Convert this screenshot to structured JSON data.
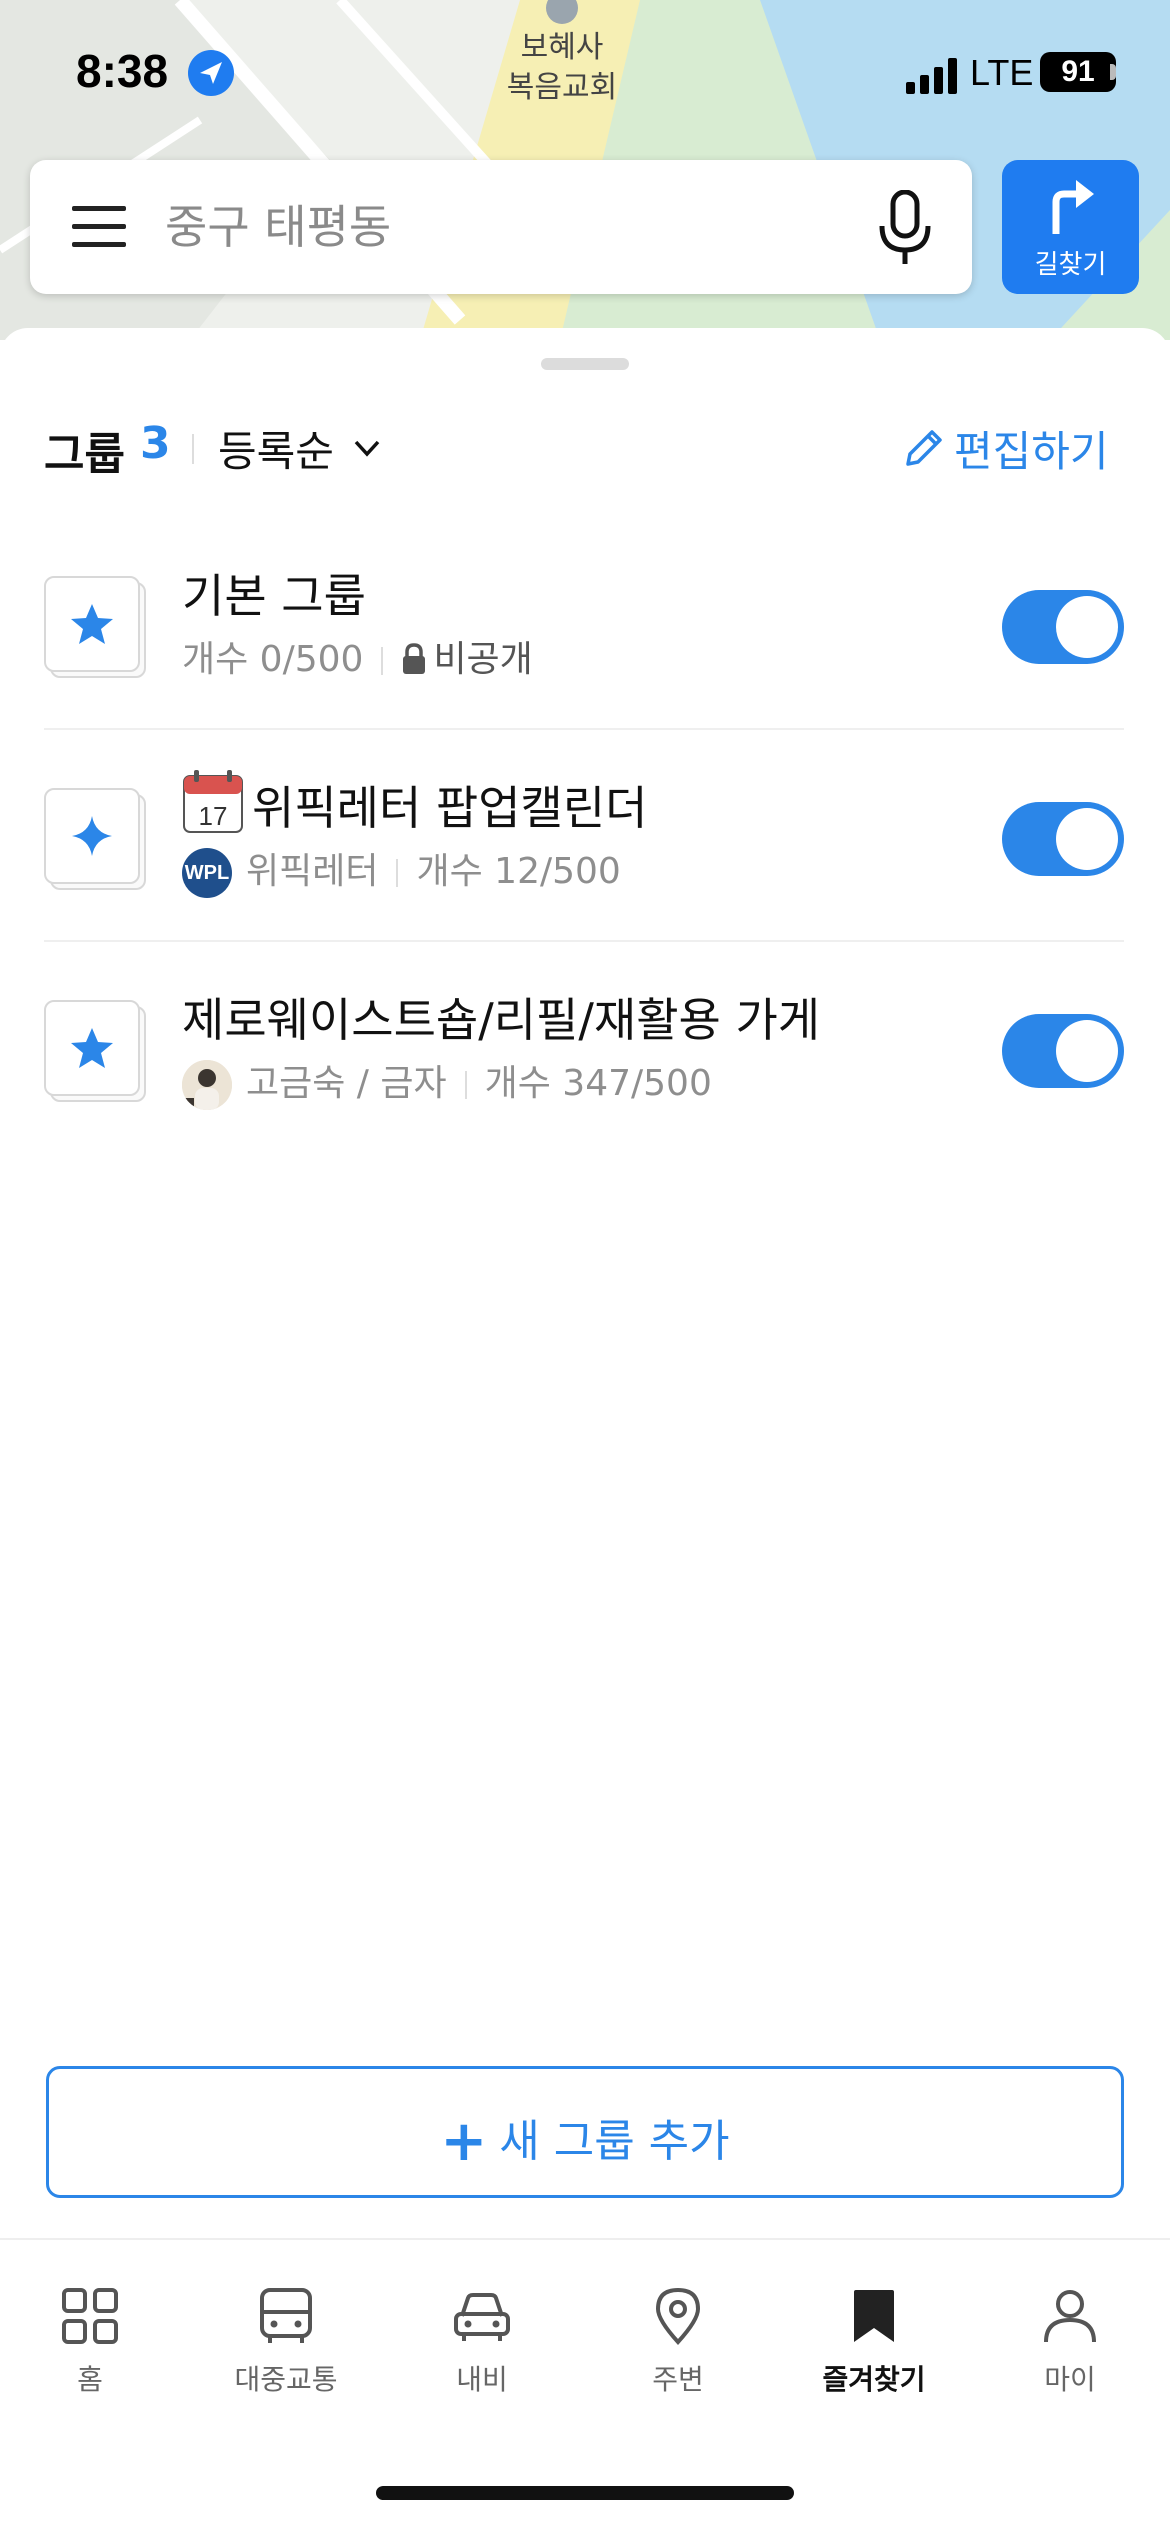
{
  "status_bar": {
    "time": "8:38",
    "network": "LTE",
    "battery": "91"
  },
  "map": {
    "labels": [
      "보혜사",
      "복음교회"
    ]
  },
  "search": {
    "placeholder": "중구 태평동"
  },
  "route_button": {
    "label": "길찾기"
  },
  "header": {
    "group_label": "그룹",
    "group_count": "3",
    "sort_label": "등록순",
    "edit_label": "편집하기"
  },
  "groups": [
    {
      "title": "기본 그룹",
      "count_label": "개수 0/500",
      "visibility": "비공개",
      "enabled": true
    },
    {
      "title": "위픽레터 팝업캘린더",
      "owner_badge": "WPL",
      "owner": "위픽레터",
      "count_label": "개수 12/500",
      "enabled": true
    },
    {
      "title": "제로웨이스트숍/리필/재활용 가게",
      "owner": "고금숙 / 금자",
      "count_label": "개수 347/500",
      "enabled": true
    }
  ],
  "add_group": {
    "label": "새 그룹 추가"
  },
  "bottom_nav": [
    {
      "label": "홈",
      "icon": "grid-icon"
    },
    {
      "label": "대중교통",
      "icon": "bus-icon"
    },
    {
      "label": "내비",
      "icon": "car-icon"
    },
    {
      "label": "주변",
      "icon": "location-pin-icon"
    },
    {
      "label": "즐겨찾기",
      "icon": "bookmark-icon",
      "active": true
    },
    {
      "label": "마이",
      "icon": "person-icon"
    }
  ],
  "colors": {
    "accent": "#2b86e8",
    "route_button": "#1f7cf0"
  }
}
